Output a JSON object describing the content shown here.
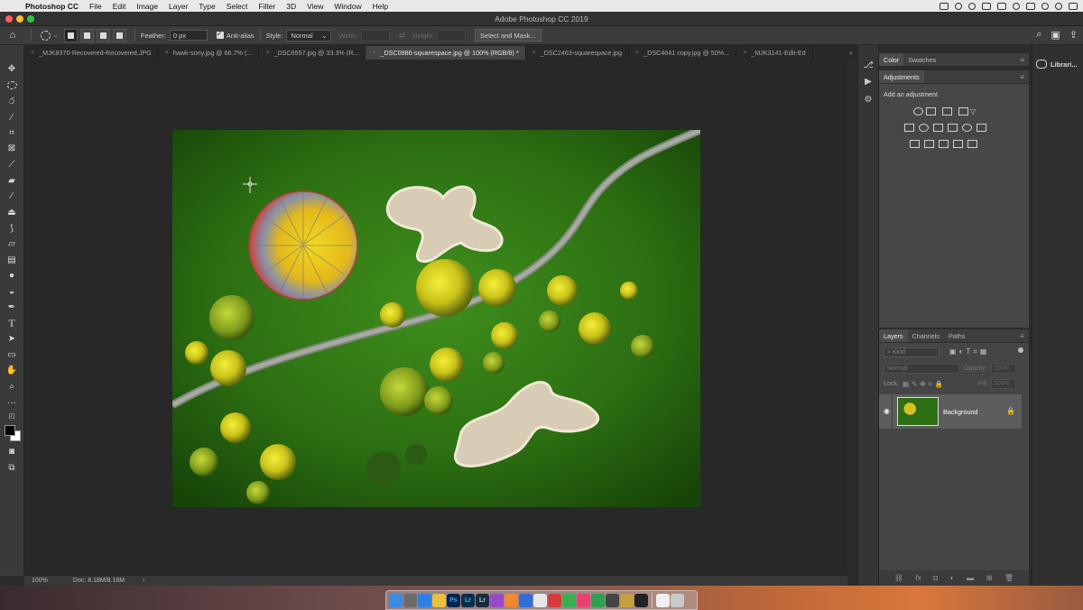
{
  "menubar": {
    "app": "Photoshop CC",
    "items": [
      "File",
      "Edit",
      "Image",
      "Layer",
      "Type",
      "Select",
      "Filter",
      "3D",
      "View",
      "Window",
      "Help"
    ]
  },
  "window": {
    "title": "Adobe Photoshop CC 2019"
  },
  "options": {
    "feather_label": "Feather:",
    "feather_value": "0 px",
    "antialias_label": "Anti-alias",
    "style_label": "Style:",
    "style_value": "Normal",
    "width_label": "Width:",
    "height_label": "Height:",
    "select_mask_label": "Select and Mask..."
  },
  "tabs": [
    {
      "label": "_MJK8370-Recovered-Recovered.JPG",
      "active": false
    },
    {
      "label": "hawk-sony.jpg @ 66.7% (...",
      "active": false
    },
    {
      "label": "_DSC6557.jpg @ 33.3% (R...",
      "active": false
    },
    {
      "label": "_DSC0986-squarespace.jpg @ 100% (RGB/8) *",
      "active": true
    },
    {
      "label": "_DSC2463-squarespace.jpg",
      "active": false
    },
    {
      "label": "_DSC4641 copy.jpg @ 50%...",
      "active": false
    },
    {
      "label": "_MJK3141-Edit-Ed",
      "active": false
    }
  ],
  "tabs_more": "»",
  "status": {
    "zoom": "100%",
    "doc": "Doc: 8.18M/8.18M",
    "arrow": "›"
  },
  "panels": {
    "color_tab": "Color",
    "swatches_tab": "Swatches",
    "adjustments_title": "Adjustments",
    "add_adjustment": "Add an adjustment",
    "layers_tab": "Layers",
    "channels_tab": "Channels",
    "paths_tab": "Paths",
    "kind_placeholder": "Kind",
    "blend_mode": "Normal",
    "opacity_label": "Opacity:",
    "opacity_value": "100%",
    "lock_label": "Lock:",
    "fill_label": "Fill:",
    "fill_value": "100%",
    "layer_name": "Background"
  },
  "libraries": {
    "label": "Librari..."
  },
  "icons": {
    "home": "home-icon",
    "search": "search-icon"
  }
}
